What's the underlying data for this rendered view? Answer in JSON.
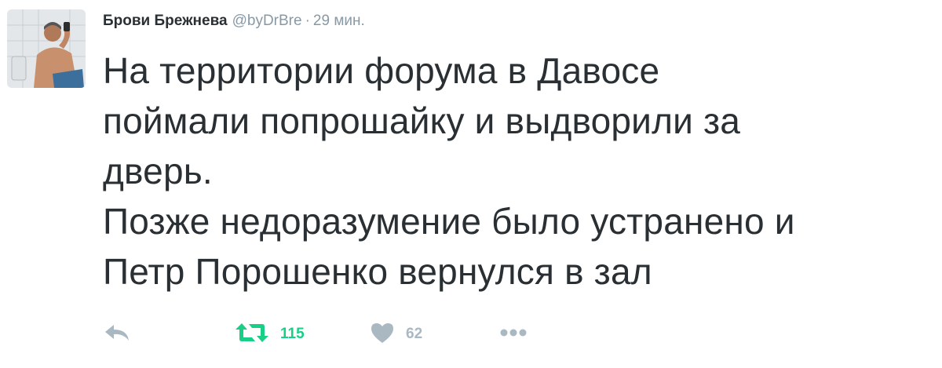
{
  "tweet": {
    "author": {
      "name": "Брови Брежнева",
      "handle": "@byDrBre",
      "separator": "·",
      "time": "29 мин."
    },
    "text_lines": [
      "На территории форума в Давосе",
      "поймали попрошайку и выдворили за",
      "дверь.",
      "Позже недоразумение было устранено и",
      "Петр Порошенко вернулся в зал"
    ],
    "actions": {
      "reply_icon": "reply-icon",
      "retweet_icon": "retweet-icon",
      "retweet_count": "115",
      "like_icon": "heart-icon",
      "like_count": "62",
      "more_icon": "more-icon"
    }
  },
  "colors": {
    "text": "#292f33",
    "muted": "#8899a6",
    "retweet_active": "#19cf86",
    "icon_gray": "#aab8c2"
  }
}
